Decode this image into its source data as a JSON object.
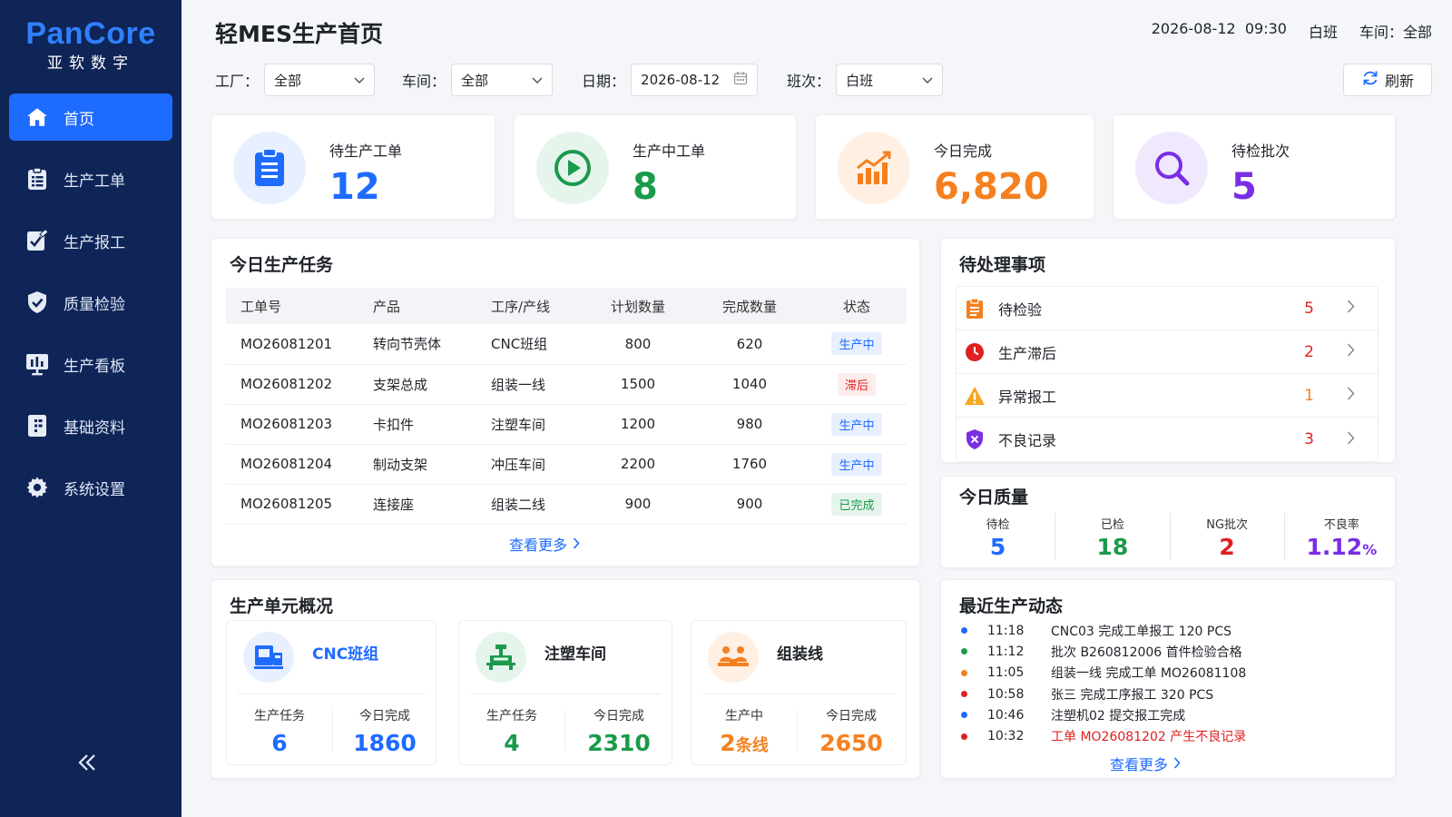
{
  "brand": {
    "name": "PanCore",
    "sub": "亚软数字"
  },
  "nav": [
    {
      "id": "home",
      "label": "首页",
      "icon": "home-icon",
      "active": true
    },
    {
      "id": "orders",
      "label": "生产工单",
      "icon": "clipboard-list-icon"
    },
    {
      "id": "report",
      "label": "生产报工",
      "icon": "edit-check-icon"
    },
    {
      "id": "quality",
      "label": "质量检验",
      "icon": "shield-check-icon"
    },
    {
      "id": "board",
      "label": "生产看板",
      "icon": "dashboard-icon"
    },
    {
      "id": "base",
      "label": "基础资料",
      "icon": "document-icon"
    },
    {
      "id": "settings",
      "label": "系统设置",
      "icon": "gear-icon"
    }
  ],
  "header": {
    "title": "轻MES生产首页",
    "datetime": "2026-08-12  09:30",
    "shift": "白班",
    "workshop": "车间：全部"
  },
  "filters": {
    "factory_label": "工厂：",
    "factory_value": "全部",
    "workshop_label": "车间：",
    "workshop_value": "全部",
    "date_label": "日期：",
    "date_value": "2026-08-12",
    "shift_label": "班次：",
    "shift_value": "白班",
    "refresh_label": "刷新"
  },
  "stats": [
    {
      "label": "待生产工单",
      "value": "12",
      "color": "#1e6bff",
      "bg": "#e8f0ff",
      "icon": "clipboard-icon"
    },
    {
      "label": "生产中工单",
      "value": "8",
      "color": "#1a9a4b",
      "bg": "#e6f5ec",
      "icon": "play-icon"
    },
    {
      "label": "今日完成",
      "value": "6,820",
      "color": "#f5801f",
      "bg": "#fff0e3",
      "icon": "bar-chart-icon"
    },
    {
      "label": "待检批次",
      "value": "5",
      "color": "#7a2ee6",
      "bg": "#f0e9fd",
      "icon": "search-icon"
    }
  ],
  "tasks": {
    "title": "今日生产任务",
    "columns": [
      "工单号",
      "产品",
      "工序/产线",
      "计划数量",
      "完成数量",
      "状态"
    ],
    "rows": [
      {
        "id": "MO26081201",
        "product": "转向节壳体",
        "line": "CNC班组",
        "plan": "800",
        "done": "620",
        "status": "生产中",
        "kind": "running"
      },
      {
        "id": "MO26081202",
        "product": "支架总成",
        "line": "组装一线",
        "plan": "1500",
        "done": "1040",
        "status": "滞后",
        "kind": "late"
      },
      {
        "id": "MO26081203",
        "product": "卡扣件",
        "line": "注塑车间",
        "plan": "1200",
        "done": "980",
        "status": "生产中",
        "kind": "running"
      },
      {
        "id": "MO26081204",
        "product": "制动支架",
        "line": "冲压车间",
        "plan": "2200",
        "done": "1760",
        "status": "生产中",
        "kind": "running"
      },
      {
        "id": "MO26081205",
        "product": "连接座",
        "line": "组装二线",
        "plan": "900",
        "done": "900",
        "status": "已完成",
        "kind": "done"
      }
    ],
    "more": "查看更多"
  },
  "pending": {
    "title": "待处理事项",
    "items": [
      {
        "label": "待检验",
        "count": "5",
        "icon": "clipboard-orange-icon"
      },
      {
        "label": "生产滞后",
        "count": "2",
        "icon": "clock-red-icon"
      },
      {
        "label": "异常报工",
        "count": "1",
        "icon": "warning-icon"
      },
      {
        "label": "不良记录",
        "count": "3",
        "icon": "shield-x-icon"
      }
    ]
  },
  "quality": {
    "title": "今日质量",
    "items": [
      {
        "label": "待检",
        "value": "5",
        "unit": "",
        "color": "#1e6bff"
      },
      {
        "label": "已检",
        "value": "18",
        "unit": "",
        "color": "#1a9a4b"
      },
      {
        "label": "NG批次",
        "value": "2",
        "unit": "",
        "color": "#e02020"
      },
      {
        "label": "不良率",
        "value": "1.12",
        "unit": "%",
        "color": "#7a2ee6"
      }
    ]
  },
  "units": {
    "title": "生产单元概况",
    "items": [
      {
        "name": "CNC班组",
        "name_color": "#1e6bff",
        "icon": "cnc-machine-icon",
        "icon_bg": "#e8f0ff",
        "l1": "生产任务",
        "v1": "6",
        "u1": "",
        "c1": "#1e6bff",
        "l2": "今日完成",
        "v2": "1860",
        "c2": "#1e6bff"
      },
      {
        "name": "注塑车间",
        "name_color": "#1f2329",
        "icon": "injection-machine-icon",
        "icon_bg": "#e6f5ec",
        "l1": "生产任务",
        "v1": "4",
        "u1": "",
        "c1": "#1a9a4b",
        "l2": "今日完成",
        "v2": "2310",
        "c2": "#1a9a4b"
      },
      {
        "name": "组装线",
        "name_color": "#1f2329",
        "icon": "assembly-workers-icon",
        "icon_bg": "#fff0e3",
        "l1": "生产中",
        "v1": "2",
        "u1": "条线",
        "c1": "#f5801f",
        "l2": "今日完成",
        "v2": "2650",
        "c2": "#f5801f"
      }
    ]
  },
  "feed": {
    "title": "最近生产动态",
    "items": [
      {
        "time": "11:18",
        "text": "CNC03 完成工单报工 120 PCS",
        "dot": "#1e6bff",
        "alert": false
      },
      {
        "time": "11:12",
        "text": "批次 B260812006 首件检验合格",
        "dot": "#1a9a4b",
        "alert": false
      },
      {
        "time": "11:05",
        "text": "组装一线 完成工单 MO26081108",
        "dot": "#f5801f",
        "alert": false
      },
      {
        "time": "10:58",
        "text": "张三 完成工序报工 320 PCS",
        "dot": "#e02020",
        "alert": false
      },
      {
        "time": "10:46",
        "text": "注塑机02 提交报工完成",
        "dot": "#1e6bff",
        "alert": false
      },
      {
        "time": "10:32",
        "text": "工单 MO26081202 产生不良记录",
        "dot": "#e02020",
        "alert": true
      }
    ],
    "more": "查看更多"
  }
}
